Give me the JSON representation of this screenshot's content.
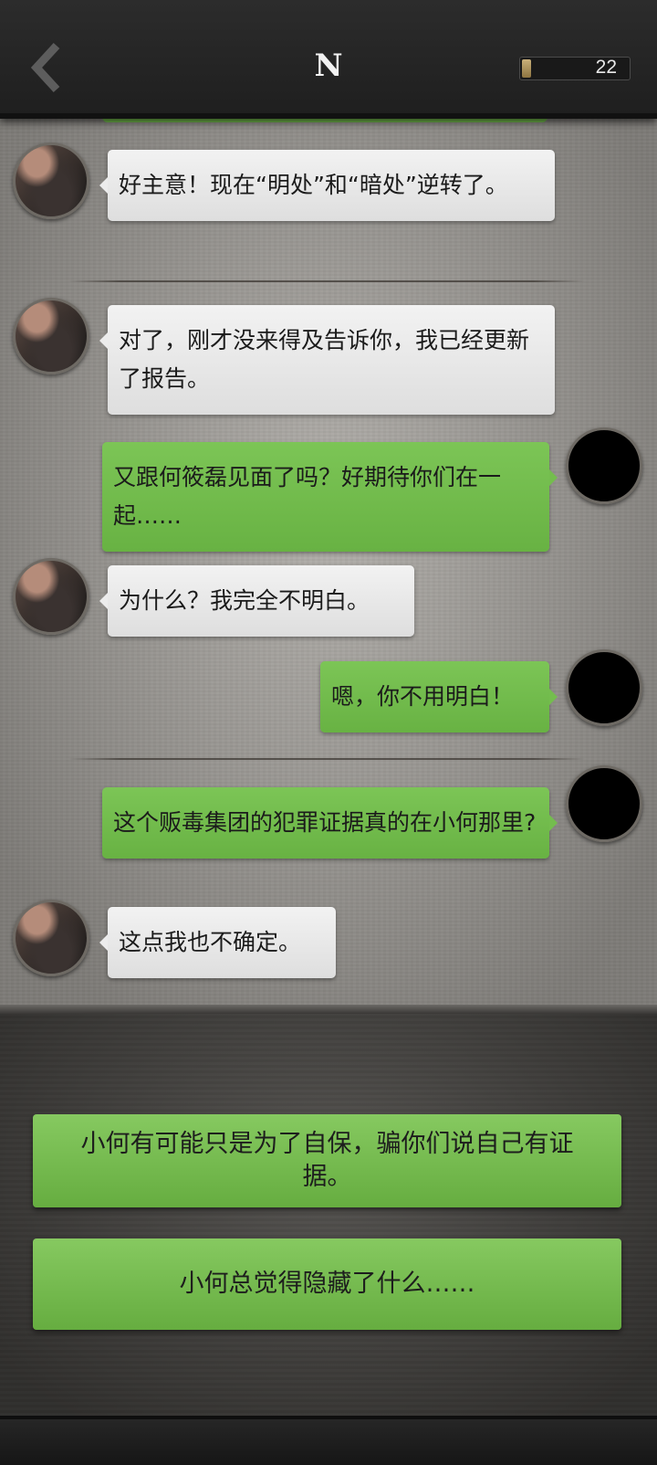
{
  "header": {
    "back_icon": "chevron-left-icon",
    "title": "N",
    "counter_value": "22",
    "counter_fill_color": "#b09a63"
  },
  "messages": [
    {
      "side": "left",
      "text": "好主意！现在“明处”和“暗处”逆转了。"
    },
    {
      "side": "left",
      "text": "对了，刚才没来得及告诉你，我已经更新了报告。"
    },
    {
      "side": "right",
      "text": "又跟何筱磊见面了吗？好期待你们在一起……"
    },
    {
      "side": "left",
      "text": "为什么？我完全不明白。"
    },
    {
      "side": "right",
      "text": "嗯，你不用明白！"
    },
    {
      "side": "right",
      "text": "这个贩毒集团的犯罪证据真的在小何那里?"
    },
    {
      "side": "left",
      "text": "这点我也不确定。"
    }
  ],
  "choices": [
    "小何有可能只是为了自保，骗你们说自己有证据。",
    "小何总觉得隐藏了什么……"
  ],
  "colors": {
    "my_bubble": "#74bd4e",
    "their_bubble": "#ececec",
    "choice": "#76bb50"
  }
}
